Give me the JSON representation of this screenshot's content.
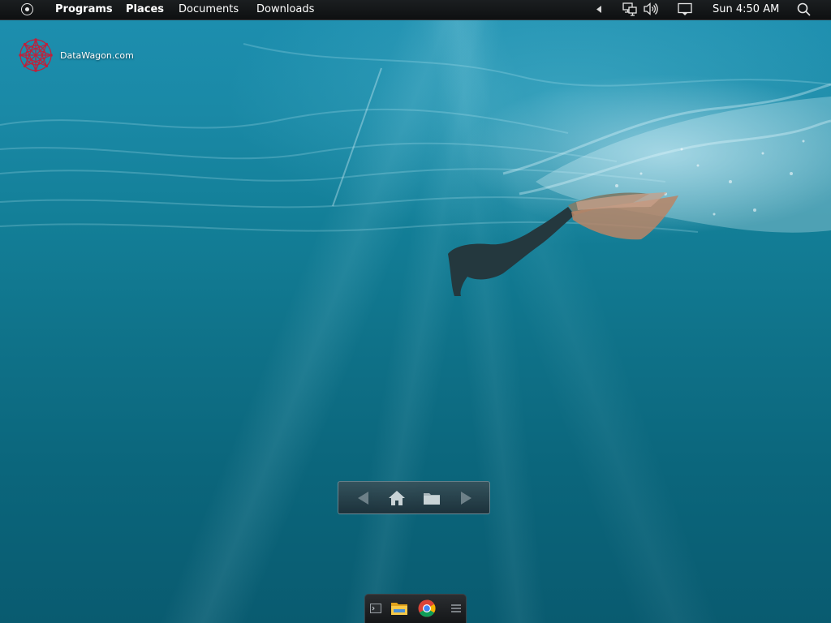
{
  "topbar": {
    "menu_icon": "circle-dot-menu-icon",
    "menus": [
      {
        "label": "Programs",
        "bold": true
      },
      {
        "label": "Places",
        "bold": true
      },
      {
        "label": "Documents",
        "bold": false
      },
      {
        "label": "Downloads",
        "bold": false
      }
    ],
    "tray": {
      "icons": [
        "tray-expand-arrow-icon",
        "network-icon",
        "volume-icon",
        "display-icon",
        "search-icon"
      ],
      "clock": "Sun 4:50 AM"
    }
  },
  "desktop": {
    "icon": {
      "label": "DataWagon.com",
      "icon": "datawagon-logo-icon",
      "color": "#c0203a"
    },
    "wallpaper": "underwater-freediver"
  },
  "navbar": {
    "buttons": [
      "back-arrow-icon",
      "home-icon",
      "folder-icon",
      "forward-arrow-icon"
    ]
  },
  "dock": {
    "items": [
      "terminal-icon",
      "file-manager-icon",
      "chrome-icon",
      "menu-lines-icon"
    ]
  },
  "colors": {
    "panel": "#111314",
    "water_top": "#1d8fb0",
    "water_bottom": "#095b70"
  }
}
